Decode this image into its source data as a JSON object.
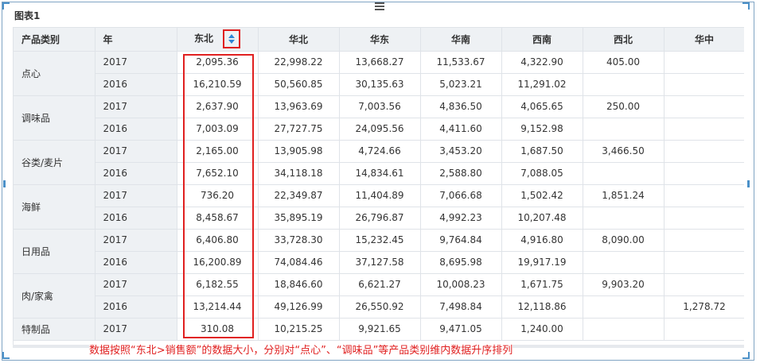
{
  "title": "图表1",
  "accent_color": "#e02020",
  "icons": {
    "drag": "drag-handle-icon",
    "sort": "sort-toggle-icon"
  },
  "headers": [
    "产品类别",
    "年",
    "东北",
    "华北",
    "华东",
    "华南",
    "西南",
    "西北",
    "华中"
  ],
  "groups": [
    {
      "category": "点心",
      "rows": [
        {
          "year": "2017",
          "values": [
            "2,095.36",
            "22,998.22",
            "13,668.27",
            "11,533.67",
            "4,322.90",
            "405.00",
            ""
          ]
        },
        {
          "year": "2016",
          "values": [
            "16,210.59",
            "50,560.85",
            "30,135.63",
            "5,023.21",
            "11,291.02",
            "",
            ""
          ]
        }
      ]
    },
    {
      "category": "调味品",
      "rows": [
        {
          "year": "2017",
          "values": [
            "2,637.90",
            "13,963.69",
            "7,003.56",
            "4,836.50",
            "4,065.65",
            "250.00",
            ""
          ]
        },
        {
          "year": "2016",
          "values": [
            "7,003.09",
            "27,727.75",
            "24,095.56",
            "4,411.60",
            "9,152.98",
            "",
            ""
          ]
        }
      ]
    },
    {
      "category": "谷类/麦片",
      "rows": [
        {
          "year": "2017",
          "values": [
            "2,165.00",
            "13,905.98",
            "4,724.66",
            "3,453.20",
            "1,687.50",
            "3,466.50",
            ""
          ]
        },
        {
          "year": "2016",
          "values": [
            "7,652.10",
            "34,118.18",
            "14,834.61",
            "2,588.80",
            "7,088.05",
            "",
            ""
          ]
        }
      ]
    },
    {
      "category": "海鲜",
      "rows": [
        {
          "year": "2017",
          "values": [
            "736.20",
            "22,349.87",
            "11,404.89",
            "7,066.68",
            "1,502.42",
            "1,851.24",
            ""
          ]
        },
        {
          "year": "2016",
          "values": [
            "8,458.67",
            "35,895.19",
            "26,796.87",
            "4,992.23",
            "10,207.48",
            "",
            ""
          ]
        }
      ]
    },
    {
      "category": "日用品",
      "rows": [
        {
          "year": "2017",
          "values": [
            "6,406.80",
            "33,728.30",
            "15,232.45",
            "9,764.84",
            "4,916.80",
            "8,090.00",
            ""
          ]
        },
        {
          "year": "2016",
          "values": [
            "16,200.89",
            "74,084.46",
            "37,127.58",
            "8,695.98",
            "19,917.19",
            "",
            ""
          ]
        }
      ]
    },
    {
      "category": "肉/家禽",
      "rows": [
        {
          "year": "2017",
          "values": [
            "6,182.55",
            "18,846.60",
            "6,621.27",
            "10,008.23",
            "1,671.75",
            "9,903.20",
            ""
          ]
        },
        {
          "year": "2016",
          "values": [
            "13,214.44",
            "49,126.99",
            "26,550.92",
            "7,498.84",
            "12,118.86",
            "",
            "1,278.72"
          ]
        }
      ]
    },
    {
      "category": "特制品",
      "rows": [
        {
          "year": "2017",
          "values": [
            "310.08",
            "10,215.25",
            "9,921.65",
            "9,471.05",
            "1,240.00",
            "",
            ""
          ]
        }
      ]
    }
  ],
  "caption": "数据按照“东北>销售额”的数据大小，分别对“点心”、“调味品”等产品类别维内数据升序排列"
}
